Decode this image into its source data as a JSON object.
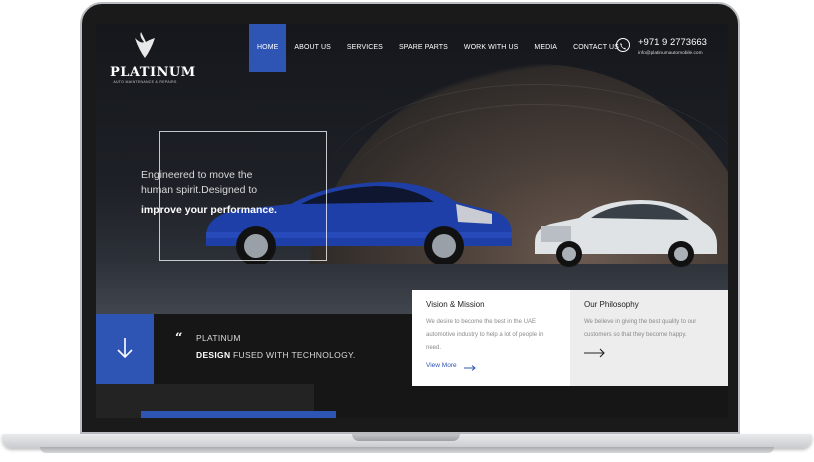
{
  "brand": {
    "name": "PLATINUM",
    "tagline": "AUTO MAINTENANCE & REPAIRS"
  },
  "nav": {
    "items": [
      "HOME",
      "ABOUT US",
      "SERVICES",
      "SPARE PARTS",
      "WORK WITH US",
      "MEDIA",
      "CONTACT US"
    ],
    "active": "HOME"
  },
  "contact": {
    "phone": "+971 9 2773663",
    "email": "info@platinumautomobile.com",
    "icon": "phone-icon"
  },
  "hero": {
    "line1": "Engineered to move the",
    "line2": "human spirit.Designed to",
    "line3": "improve your performance."
  },
  "quote": {
    "line1": "PLATINUM",
    "line2_bold": "DESIGN",
    "line2_rest": " FUSED WITH TECHNOLOGY."
  },
  "cards": {
    "vision": {
      "title": "Vision & Mission",
      "text": "We desire to become the best in the UAE automotive industry to help a lot of people in need.",
      "link": "View More"
    },
    "philosophy": {
      "title": "Our Philosophy",
      "text": "We believe in giving the best quality to our customers so that they become happy."
    }
  },
  "colors": {
    "accent": "#2f55b4",
    "dark": "#161616"
  }
}
